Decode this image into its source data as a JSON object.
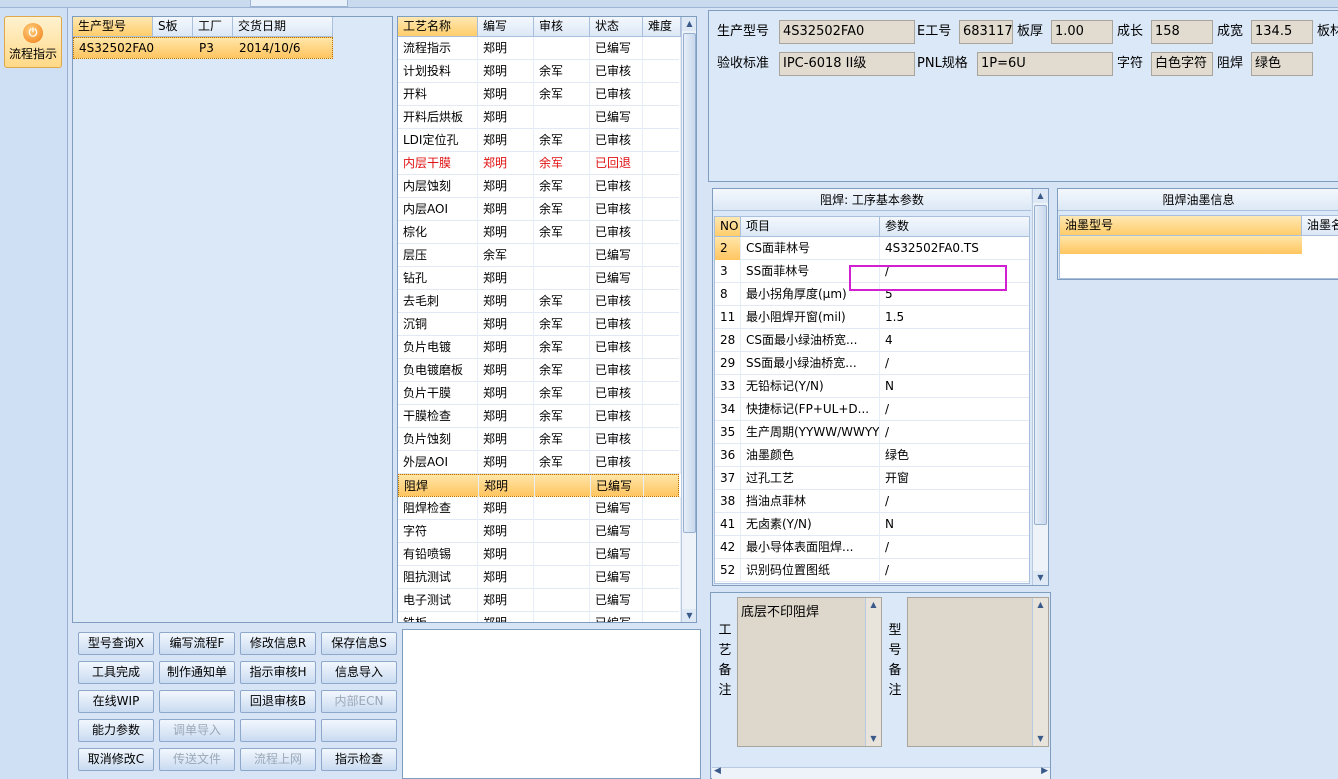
{
  "nav": {
    "label": "流程指示"
  },
  "model_list": {
    "headers": [
      "生产型号",
      "S板",
      "工厂",
      "交货日期"
    ],
    "rows": [
      [
        "4S32502FA0",
        "",
        "P3",
        "2014/10/6"
      ]
    ]
  },
  "process": {
    "headers": [
      "工艺名称",
      "编写",
      "审核",
      "状态",
      "难度"
    ],
    "rows": [
      {
        "name": "流程指示",
        "writer": "郑明",
        "reviewer": "",
        "status": "已编写"
      },
      {
        "name": "计划投料",
        "writer": "郑明",
        "reviewer": "余军",
        "status": "已审核"
      },
      {
        "name": "开料",
        "writer": "郑明",
        "reviewer": "余军",
        "status": "已审核"
      },
      {
        "name": "开料后烘板",
        "writer": "郑明",
        "reviewer": "",
        "status": "已编写"
      },
      {
        "name": "LDI定位孔",
        "writer": "郑明",
        "reviewer": "余军",
        "status": "已审核"
      },
      {
        "name": "内层干膜",
        "writer": "郑明",
        "reviewer": "余军",
        "status": "已回退",
        "red": true
      },
      {
        "name": "内层蚀刻",
        "writer": "郑明",
        "reviewer": "余军",
        "status": "已审核"
      },
      {
        "name": "内层AOI",
        "writer": "郑明",
        "reviewer": "余军",
        "status": "已审核"
      },
      {
        "name": "棕化",
        "writer": "郑明",
        "reviewer": "余军",
        "status": "已审核"
      },
      {
        "name": "层压",
        "writer": "余军",
        "reviewer": "",
        "status": "已编写"
      },
      {
        "name": "钻孔",
        "writer": "郑明",
        "reviewer": "",
        "status": "已编写"
      },
      {
        "name": "去毛刺",
        "writer": "郑明",
        "reviewer": "余军",
        "status": "已审核"
      },
      {
        "name": "沉铜",
        "writer": "郑明",
        "reviewer": "余军",
        "status": "已审核"
      },
      {
        "name": "负片电镀",
        "writer": "郑明",
        "reviewer": "余军",
        "status": "已审核"
      },
      {
        "name": "负电镀磨板",
        "writer": "郑明",
        "reviewer": "余军",
        "status": "已审核"
      },
      {
        "name": "负片干膜",
        "writer": "郑明",
        "reviewer": "余军",
        "status": "已审核"
      },
      {
        "name": "干膜检查",
        "writer": "郑明",
        "reviewer": "余军",
        "status": "已审核"
      },
      {
        "name": "负片蚀刻",
        "writer": "郑明",
        "reviewer": "余军",
        "status": "已审核"
      },
      {
        "name": "外层AOI",
        "writer": "郑明",
        "reviewer": "余军",
        "status": "已审核"
      },
      {
        "name": "阻焊",
        "writer": "郑明",
        "reviewer": "",
        "status": "已编写",
        "selected": true
      },
      {
        "name": "阻焊检查",
        "writer": "郑明",
        "reviewer": "",
        "status": "已编写"
      },
      {
        "name": "字符",
        "writer": "郑明",
        "reviewer": "",
        "status": "已编写"
      },
      {
        "name": "有铅喷锡",
        "writer": "郑明",
        "reviewer": "",
        "status": "已编写"
      },
      {
        "name": "阻抗测试",
        "writer": "郑明",
        "reviewer": "",
        "status": "已编写"
      },
      {
        "name": "电子测试",
        "writer": "郑明",
        "reviewer": "",
        "status": "已编写"
      },
      {
        "name": "铣板",
        "writer": "郑明",
        "reviewer": "",
        "status": "已编写"
      }
    ]
  },
  "buttons": [
    [
      "型号查询X",
      "编写流程F",
      "修改信息R",
      "保存信息S"
    ],
    [
      "工具完成",
      "制作通知单",
      "指示审核H",
      "信息导入"
    ],
    [
      "在线WIP",
      "",
      "回退审核B",
      "内部ECN"
    ],
    [
      "能力参数",
      "调单导入",
      "",
      ""
    ],
    [
      "取消修改C",
      "传送文件",
      "流程上网",
      "指示检查"
    ]
  ],
  "buttons_disabled": [
    [
      false,
      false,
      false,
      false
    ],
    [
      false,
      false,
      false,
      false
    ],
    [
      false,
      false,
      false,
      true
    ],
    [
      false,
      true,
      false,
      false
    ],
    [
      false,
      true,
      true,
      false
    ]
  ],
  "info": {
    "model_label": "生产型号",
    "model": "4S32502FA0",
    "e_label": "E工号",
    "e": "683117",
    "thick_label": "板厚",
    "thick": "1.00",
    "len_label": "成长",
    "len": "158",
    "width_label": "成宽",
    "width": "134.5",
    "mat_label": "板材",
    "std_label": "验收标准",
    "std": "IPC-6018 II级",
    "pnl_label": "PNL规格",
    "pnl": "1P=6U",
    "char_label": "字符",
    "char": "白色字符",
    "mask_label": "阻焊",
    "mask": "绿色"
  },
  "params": {
    "title": "阻焊: 工序基本参数",
    "headers": [
      "NO",
      "项目",
      "参数"
    ],
    "rows": [
      [
        "2",
        "CS面菲林号",
        "4S32502FA0.TS"
      ],
      [
        "3",
        "SS面菲林号",
        "/"
      ],
      [
        "8",
        "最小拐角厚度(μm)",
        "5"
      ],
      [
        "11",
        "最小阻焊开窗(mil)",
        "1.5"
      ],
      [
        "28",
        "CS面最小绿油桥宽...",
        "4"
      ],
      [
        "29",
        "SS面最小绿油桥宽...",
        "/"
      ],
      [
        "33",
        "无铅标记(Y/N)",
        "N"
      ],
      [
        "34",
        "快捷标记(FP+UL+D...",
        "/"
      ],
      [
        "35",
        "生产周期(YYWW/WWYY)",
        "/"
      ],
      [
        "36",
        "油墨颜色",
        "绿色"
      ],
      [
        "37",
        "过孔工艺",
        "开窗"
      ],
      [
        "38",
        "挡油点菲林",
        "/"
      ],
      [
        "41",
        "无卤素(Y/N)",
        "N"
      ],
      [
        "42",
        "最小导体表面阻焊...",
        "/"
      ],
      [
        "52",
        "识别码位置图纸",
        "/"
      ]
    ]
  },
  "ink": {
    "title": "阻焊油墨信息",
    "headers": [
      "油墨型号",
      "油墨名"
    ]
  },
  "remarks": {
    "process_label": "工艺备注",
    "process_text": "底层不印阻焊",
    "model_label": "型号备注",
    "model_text": ""
  },
  "colors": {
    "highlight": "#d020d0",
    "selected_row": "#ffc560",
    "panel": "#dbe8f8"
  }
}
